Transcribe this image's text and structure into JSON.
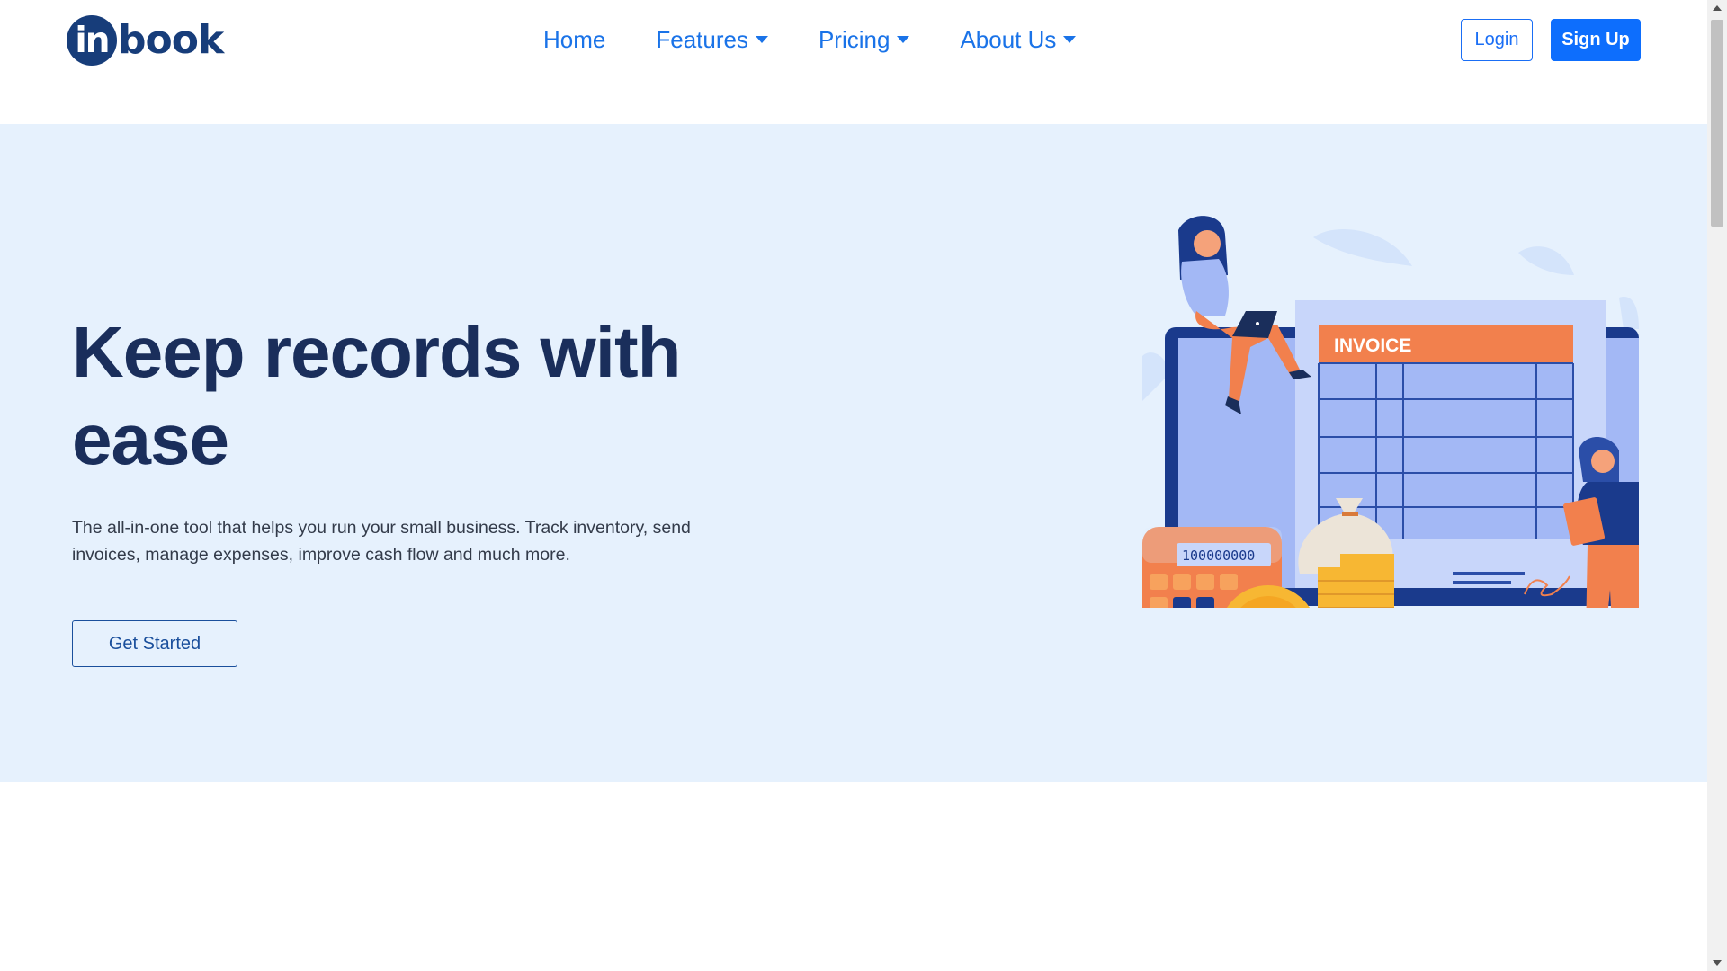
{
  "brand": {
    "logo_circle": "in",
    "logo_text": "book",
    "color": "#173d7a"
  },
  "nav": {
    "items": [
      {
        "label": "Home",
        "dropdown": false
      },
      {
        "label": "Features",
        "dropdown": true
      },
      {
        "label": "Pricing",
        "dropdown": true
      },
      {
        "label": "About Us",
        "dropdown": true
      }
    ],
    "login_label": "Login",
    "signup_label": "Sign Up"
  },
  "hero": {
    "title": "Keep records with ease",
    "subtitle": "The all-in-one tool that helps you run your small business. Track inventory, send invoices, manage expenses, improve cash flow and much more.",
    "cta_label": "Get Started",
    "background": "#e6f1fd"
  },
  "illustration": {
    "invoice_label": "INVOICE",
    "calculator_display": "100000000",
    "coin_symbol": "$"
  },
  "colors": {
    "accent": "#0d6efd",
    "link": "#1a73e8",
    "heading": "#1a2e5b",
    "orange": "#f2804d"
  },
  "icons": [
    "caret-down-icon",
    "scroll-up-arrow-icon",
    "scroll-down-arrow-icon"
  ]
}
